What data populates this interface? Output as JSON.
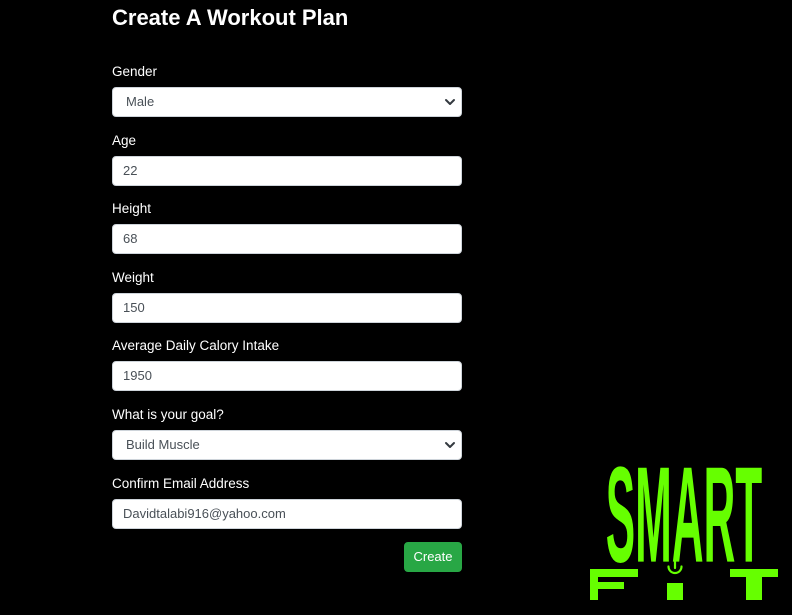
{
  "page": {
    "title": "Create A Workout Plan"
  },
  "form": {
    "gender": {
      "label": "Gender",
      "value": "Male"
    },
    "age": {
      "label": "Age",
      "value": "22"
    },
    "height": {
      "label": "Height",
      "value": "68"
    },
    "weight": {
      "label": "Weight",
      "value": "150"
    },
    "calories": {
      "label": "Average Daily Calory Intake",
      "value": "1950"
    },
    "goal": {
      "label": "What is your goal?",
      "value": "Build Muscle"
    },
    "email": {
      "label": "Confirm Email Address",
      "value": "Davidtalabi916@yahoo.com"
    },
    "submit_label": "Create"
  },
  "logo": {
    "text_top": "SMART",
    "text_bottom": "FIT",
    "color": "#66ff00",
    "icon": "power-icon"
  },
  "colors": {
    "background": "#000000",
    "button": "#28a745"
  }
}
